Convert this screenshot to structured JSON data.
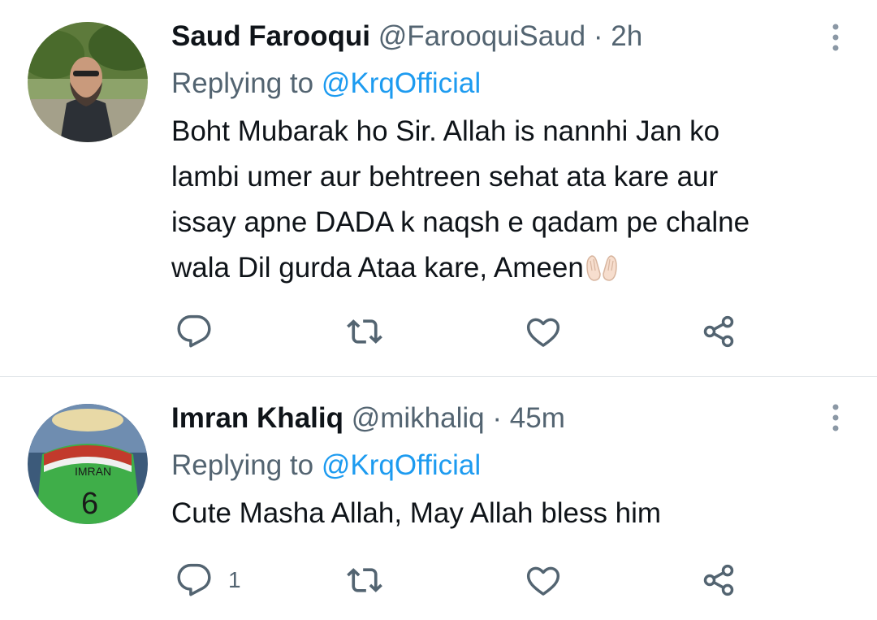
{
  "tweets": [
    {
      "display_name": "Saud Farooqui",
      "handle": "@FarooquiSaud",
      "separator": "·",
      "time": "2h",
      "replying_prefix": "Replying to ",
      "replying_to": "@KrqOfficial",
      "text": "Boht Mubarak ho Sir. Allah is nannhi Jan ko lambi umer aur behtreen sehat ata kare aur issay apne DADA k naqsh e qadam pe chalne wala Dil gurda Ataa kare, Ameen",
      "text_lines": [
        "Boht Mubarak ho Sir. Allah is nannhi Jan ko",
        "lambi umer aur behtreen sehat ata kare aur",
        "issay apne DADA k naqsh e qadam pe chalne",
        "wala Dil gurda Ataa kare, Ameen"
      ],
      "emoji": "palms-up-together-light-skin-tone",
      "reply_count": "",
      "retweet_count": "",
      "like_count": ""
    },
    {
      "display_name": "Imran Khaliq",
      "handle": "@mikhaliq",
      "separator": "·",
      "time": "45m",
      "replying_prefix": "Replying to ",
      "replying_to": "@KrqOfficial",
      "text_lines": [
        "Cute Masha Allah, May Allah bless him"
      ],
      "jersey_text": "IMRAN",
      "jersey_number": "6",
      "reply_count": "1",
      "retweet_count": "",
      "like_count": ""
    }
  ],
  "icons": {
    "reply": "reply-icon",
    "retweet": "retweet-icon",
    "like": "heart-icon",
    "share": "share-icon",
    "more": "more-vertical-icon"
  },
  "colors": {
    "text_primary": "#0f1419",
    "text_secondary": "#536471",
    "link": "#1d9bf0",
    "divider": "#dfe3e7"
  }
}
